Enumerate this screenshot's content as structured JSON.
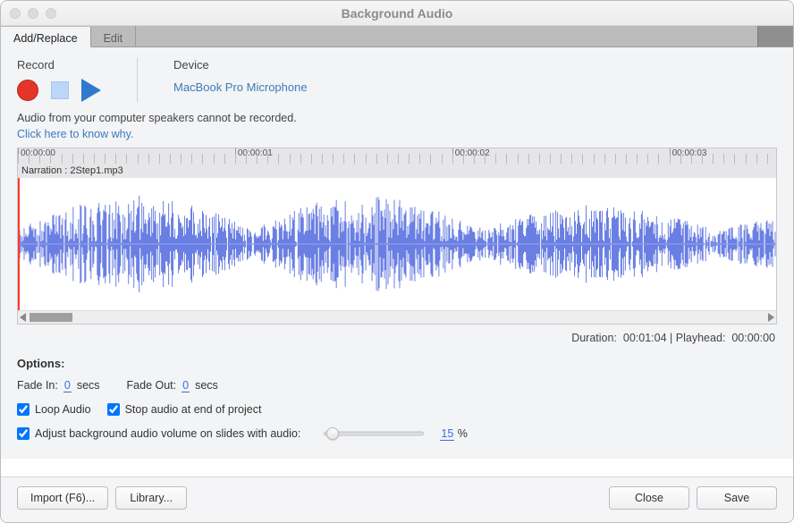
{
  "window": {
    "title": "Background Audio"
  },
  "tabs": {
    "add_replace": "Add/Replace",
    "edit": "Edit",
    "active": "add_replace"
  },
  "record_section": {
    "label": "Record"
  },
  "device_section": {
    "label": "Device",
    "value": "MacBook Pro Microphone"
  },
  "notice": {
    "line1": "Audio from your computer speakers cannot be recorded.",
    "link": "Click here to know why."
  },
  "ruler": {
    "marks": [
      "00:00:00",
      "00:00:01",
      "00:00:02",
      "00:00:03"
    ]
  },
  "file_label": "Narration : 2Step1.mp3",
  "status": {
    "duration_label": "Duration:",
    "duration_value": "00:01:04",
    "playhead_label": "Playhead:",
    "playhead_value": "00:00:00",
    "separator": " | "
  },
  "options": {
    "header": "Options:",
    "fade_in_label": "Fade In:",
    "fade_in_value": "0",
    "secs": "secs",
    "fade_out_label": "Fade Out:",
    "fade_out_value": "0",
    "loop_label": "Loop Audio",
    "stopend_label": "Stop audio at end of project",
    "adjust_label": "Adjust background audio volume on slides with audio:",
    "volume_value": "15",
    "percent": "%"
  },
  "footer": {
    "import": "Import (F6)...",
    "library": "Library...",
    "close": "Close",
    "save": "Save"
  },
  "icons": {
    "record": "record-icon",
    "stop": "stop-icon",
    "play": "play-icon"
  },
  "chart_data": {
    "type": "line",
    "note": "audio waveform amplitude envelope sampled across visible timeline",
    "x_range_seconds": [
      0,
      3.5
    ],
    "amplitude_range": [
      -1,
      1
    ],
    "samples_approx": 850,
    "series": [
      {
        "name": "waveform",
        "description": "dense bipolar audio amplitude; peaks roughly ±0.8, densest between 0.5s and 2.5s"
      }
    ]
  }
}
